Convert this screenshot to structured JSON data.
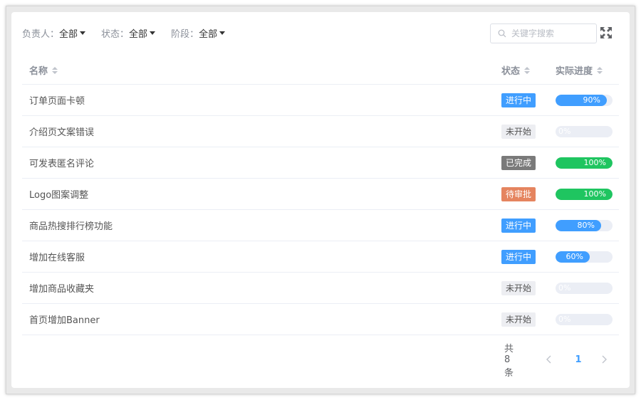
{
  "filters": [
    {
      "label": "负责人：",
      "value": "全部"
    },
    {
      "label": "状态：",
      "value": "全部"
    },
    {
      "label": "阶段：",
      "value": "全部"
    }
  ],
  "search": {
    "placeholder": "关键字搜索"
  },
  "table": {
    "headers": {
      "name": "名称",
      "status": "状态",
      "progress": "实际进度"
    },
    "rows": [
      {
        "name": "订单页面卡顿",
        "status": "进行中",
        "status_color": "#409eff",
        "progress": 0.9,
        "progress_label": "90%",
        "bar_color": "#409eff"
      },
      {
        "name": "介绍页文案错误",
        "status": "未开始",
        "status_color": "#edeef2",
        "progress": 0,
        "progress_label": "0%",
        "bar_color": "#409eff"
      },
      {
        "name": "可发表匿名评论",
        "status": "已完成",
        "status_color": "#7a7a7a",
        "progress": 1.0,
        "progress_label": "100%",
        "bar_color": "#1fc560"
      },
      {
        "name": "Logo图案调整",
        "status": "待审批",
        "status_color": "#e5845f",
        "progress": 1.0,
        "progress_label": "100%",
        "bar_color": "#1fc560"
      },
      {
        "name": "商品热搜排行榜功能",
        "status": "进行中",
        "status_color": "#409eff",
        "progress": 0.8,
        "progress_label": "80%",
        "bar_color": "#409eff"
      },
      {
        "name": "增加在线客服",
        "status": "进行中",
        "status_color": "#409eff",
        "progress": 0.6,
        "progress_label": "60%",
        "bar_color": "#409eff"
      },
      {
        "name": "增加商品收藏夹",
        "status": "未开始",
        "status_color": "#edeef2",
        "progress": 0,
        "progress_label": "0%",
        "bar_color": "#409eff"
      },
      {
        "name": "首页增加Banner",
        "status": "未开始",
        "status_color": "#edeef2",
        "progress": 0,
        "progress_label": "0%",
        "bar_color": "#409eff"
      }
    ]
  },
  "pagination": {
    "total_text": "共 8 条",
    "current_page": "1"
  },
  "icons": {
    "search": "search-icon",
    "fullscreen": "fullscreen-icon",
    "prev": "chevron-left-icon",
    "next": "chevron-right-icon"
  }
}
